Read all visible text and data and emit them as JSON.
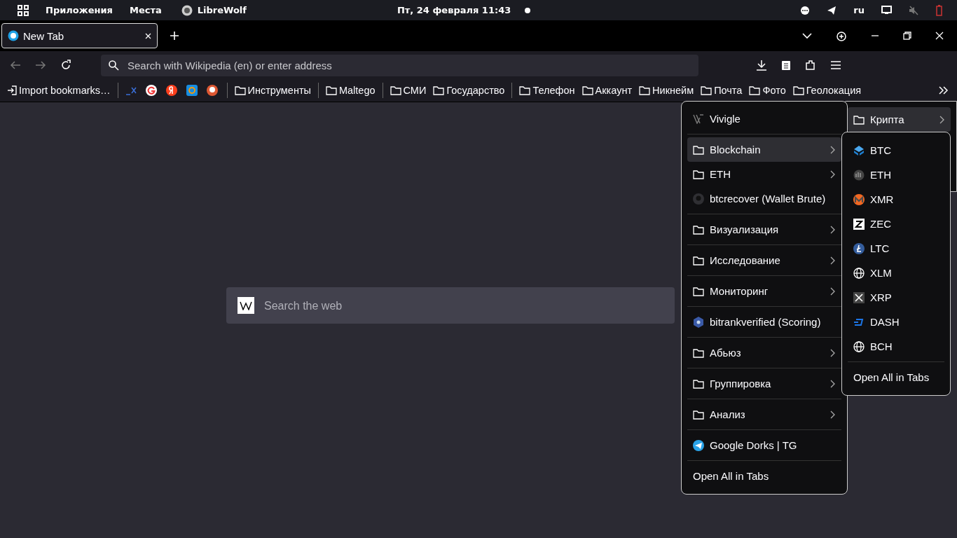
{
  "top_bar": {
    "activities": "Приложения",
    "places": "Места",
    "app": "LibreWolf",
    "datetime": "Пт, 24 февраля  11:43",
    "language": "ru"
  },
  "tabs": [
    {
      "label": "New Tab",
      "selected": true
    }
  ],
  "address_bar": {
    "placeholder": "Search with Wikipedia (en) or enter address"
  },
  "bookmarks": [
    {
      "kind": "action",
      "label": "Import bookmarks…"
    },
    {
      "kind": "separator"
    },
    {
      "kind": "site"
    },
    {
      "kind": "site"
    },
    {
      "kind": "site"
    },
    {
      "kind": "site"
    },
    {
      "kind": "site"
    },
    {
      "kind": "separator"
    },
    {
      "kind": "folder",
      "label": "Инструменты"
    },
    {
      "kind": "separator"
    },
    {
      "kind": "folder",
      "label": "Maltego"
    },
    {
      "kind": "separator"
    },
    {
      "kind": "folder",
      "label": "СМИ"
    },
    {
      "kind": "folder",
      "label": "Государство"
    },
    {
      "kind": "separator"
    },
    {
      "kind": "folder",
      "label": "Телефон"
    },
    {
      "kind": "folder",
      "label": "Аккаунт"
    },
    {
      "kind": "folder",
      "label": "Никнейм"
    },
    {
      "kind": "folder",
      "label": "Почта"
    },
    {
      "kind": "folder",
      "label": "Фото"
    },
    {
      "kind": "folder",
      "label": "Геолокация"
    }
  ],
  "web_search": {
    "placeholder": "Search the web"
  },
  "overflow_menu": [
    {
      "kind": "folder",
      "label": "Крипта",
      "selected": true
    }
  ],
  "folder_menu": [
    {
      "kind": "site",
      "label": "Vivigle",
      "selected": false
    },
    {
      "kind": "separator"
    },
    {
      "kind": "folder",
      "label": "Blockchain",
      "selected": true
    },
    {
      "kind": "folder",
      "label": "ETH",
      "selected": false
    },
    {
      "kind": "site",
      "label": "btcrecover (Wallet Brute)",
      "selected": false
    },
    {
      "kind": "separator"
    },
    {
      "kind": "folder",
      "label": "Визуализация",
      "selected": false
    },
    {
      "kind": "separator"
    },
    {
      "kind": "folder",
      "label": "Исследование",
      "selected": false
    },
    {
      "kind": "separator"
    },
    {
      "kind": "folder",
      "label": "Мониторинг",
      "selected": false
    },
    {
      "kind": "separator"
    },
    {
      "kind": "site",
      "label": "bitrankverified (Scoring)",
      "selected": false
    },
    {
      "kind": "separator"
    },
    {
      "kind": "folder",
      "label": "Абьюз",
      "selected": false
    },
    {
      "kind": "separator"
    },
    {
      "kind": "folder",
      "label": "Группировка",
      "selected": false
    },
    {
      "kind": "separator"
    },
    {
      "kind": "folder",
      "label": "Анализ",
      "selected": false
    },
    {
      "kind": "separator"
    },
    {
      "kind": "site",
      "label": "Google Dorks | TG",
      "selected": false
    },
    {
      "kind": "separator"
    },
    {
      "kind": "action",
      "label": "Open All in Tabs",
      "selected": false
    }
  ],
  "sub_menu": [
    {
      "kind": "site",
      "label": "BTC"
    },
    {
      "kind": "site",
      "label": "ETH"
    },
    {
      "kind": "site",
      "label": "XMR"
    },
    {
      "kind": "site",
      "label": "ZEC"
    },
    {
      "kind": "site",
      "label": "LTC"
    },
    {
      "kind": "site",
      "label": "XLM"
    },
    {
      "kind": "site",
      "label": "XRP"
    },
    {
      "kind": "site",
      "label": "DASH"
    },
    {
      "kind": "site",
      "label": "BCH"
    },
    {
      "kind": "separator"
    },
    {
      "kind": "action",
      "label": "Open All in Tabs"
    }
  ]
}
